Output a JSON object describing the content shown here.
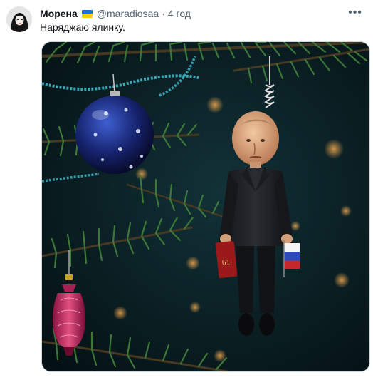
{
  "tweet": {
    "author": {
      "display_name": "Морена",
      "flag": "ukraine-flag",
      "handle": "@maradiosaa",
      "time": "4 год"
    },
    "text": "Наряджаю ялинку.",
    "more_icon": "more-horizontal-icon",
    "media": {
      "book_label": "61"
    }
  }
}
